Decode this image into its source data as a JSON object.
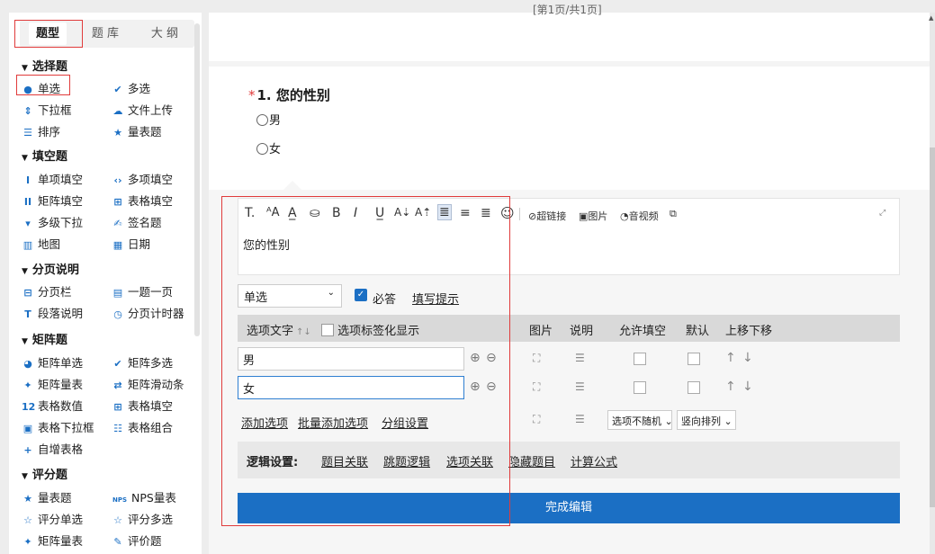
{
  "palette": {
    "brand": "#1b6fc4",
    "focus_box": "#e03b3b",
    "required": "#e03b3b"
  },
  "left_panel": {
    "tabs": [
      {
        "label": "题型",
        "active": true
      },
      {
        "label": "题 库",
        "active": false
      },
      {
        "label": "大 纲",
        "active": false
      }
    ],
    "sections": [
      {
        "title": "选择题",
        "items": [
          {
            "label": "单选",
            "icon": "radio-dot-icon",
            "glyph": "●"
          },
          {
            "label": "多选",
            "icon": "check-icon",
            "glyph": "✔"
          },
          {
            "label": "下拉框",
            "icon": "dropdown-arrows-icon",
            "glyph": "⇕"
          },
          {
            "label": "文件上传",
            "icon": "cloud-upload-icon",
            "glyph": "☁"
          },
          {
            "label": "排序",
            "icon": "list-icon",
            "glyph": "☰"
          },
          {
            "label": "量表题",
            "icon": "star-icon",
            "glyph": "★"
          }
        ]
      },
      {
        "title": "填空题",
        "items": [
          {
            "label": "单项填空",
            "icon": "text-cursor-icon",
            "glyph": "I"
          },
          {
            "label": "多项填空",
            "icon": "code-brackets-icon",
            "glyph": "‹›"
          },
          {
            "label": "矩阵填空",
            "icon": "double-cursor-icon",
            "glyph": "II"
          },
          {
            "label": "表格填空",
            "icon": "table-icon",
            "glyph": "⊞"
          },
          {
            "label": "多级下拉",
            "icon": "funnel-icon",
            "glyph": "▾"
          },
          {
            "label": "签名题",
            "icon": "pen-signature-icon",
            "glyph": "✍"
          },
          {
            "label": "地图",
            "icon": "map-icon",
            "glyph": "▥"
          },
          {
            "label": "日期",
            "icon": "calendar-icon",
            "glyph": "▦"
          }
        ]
      },
      {
        "title": "分页说明",
        "items": [
          {
            "label": "分页栏",
            "icon": "page-break-icon",
            "glyph": "⊟"
          },
          {
            "label": "一题一页",
            "icon": "single-page-icon",
            "glyph": "▤"
          },
          {
            "label": "段落说明",
            "icon": "text-t-icon",
            "glyph": "T"
          },
          {
            "label": "分页计时器",
            "icon": "timer-icon",
            "glyph": "◷"
          }
        ]
      },
      {
        "title": "矩阵题",
        "items": [
          {
            "label": "矩阵单选",
            "icon": "matrix-radio-icon",
            "glyph": "◕"
          },
          {
            "label": "矩阵多选",
            "icon": "matrix-check-icon",
            "glyph": "✔"
          },
          {
            "label": "矩阵量表",
            "icon": "matrix-star-icon",
            "glyph": "✦"
          },
          {
            "label": "矩阵滑动条",
            "icon": "slider-icon",
            "glyph": "⇄"
          },
          {
            "label": "表格数值",
            "icon": "number-12-icon",
            "glyph": "12"
          },
          {
            "label": "表格填空",
            "icon": "table-icon",
            "glyph": "⊞"
          },
          {
            "label": "表格下拉框",
            "icon": "table-dropdown-icon",
            "glyph": "▣"
          },
          {
            "label": "表格组合",
            "icon": "table-combo-icon",
            "glyph": "☷"
          },
          {
            "label": "自增表格",
            "icon": "plus-icon",
            "glyph": "+"
          }
        ]
      },
      {
        "title": "评分题",
        "items": [
          {
            "label": "量表题",
            "icon": "star-icon",
            "glyph": "★"
          },
          {
            "label": "NPS量表",
            "icon": "nps-icon",
            "glyph": "NPS"
          },
          {
            "label": "评分单选",
            "icon": "star-outline-icon",
            "glyph": "☆"
          },
          {
            "label": "评分多选",
            "icon": "star-outline-icon",
            "glyph": "☆"
          },
          {
            "label": "矩阵量表",
            "icon": "matrix-star-icon",
            "glyph": "✦"
          },
          {
            "label": "评价题",
            "icon": "pencil-icon",
            "glyph": "✎"
          }
        ]
      }
    ]
  },
  "page": {
    "pager": "[第1页/共1页]"
  },
  "question": {
    "required_mark": "*",
    "number": "1.",
    "title": "您的性别",
    "options": [
      "男",
      "女"
    ]
  },
  "editor": {
    "toolbar": {
      "items": [
        {
          "name": "clear-format-icon",
          "glyph": "T."
        },
        {
          "name": "font-size-icon",
          "glyph": "ᴬA"
        },
        {
          "name": "font-color-icon",
          "glyph": "A̲"
        },
        {
          "name": "highlight-icon",
          "glyph": "⛀"
        },
        {
          "name": "bold-icon",
          "glyph": "B"
        },
        {
          "name": "italic-icon",
          "glyph": "I"
        },
        {
          "name": "underline-icon",
          "glyph": "U̲"
        },
        {
          "name": "subscript-icon",
          "glyph": "A⇣"
        },
        {
          "name": "superscript-icon",
          "glyph": "A⇡"
        },
        {
          "name": "align-left-icon",
          "glyph": "≣"
        },
        {
          "name": "align-center-icon",
          "glyph": "≡"
        },
        {
          "name": "align-right-icon",
          "glyph": "≣"
        },
        {
          "name": "emoji-icon",
          "glyph": "☺"
        }
      ],
      "link_label": "超链接",
      "image_label": "图片",
      "media_label": "音视频",
      "expand_glyph": "⤢"
    },
    "title_text": "您的性别",
    "type_select": "单选",
    "required_label": "必答",
    "hint_link": "填写提示",
    "table": {
      "col_option_text": "选项文字",
      "sort_glyph": "↑↓",
      "col_tag_display": "选项标签化显示",
      "col_image": "图片",
      "col_desc": "说明",
      "col_fill": "允许填空",
      "col_default": "默认",
      "col_move": "上移下移",
      "rows": [
        "男",
        "女"
      ]
    },
    "add_option": "添加选项",
    "batch_add": "批量添加选项",
    "group_setting": "分组设置",
    "random_select": "选项不随机",
    "layout_select": "竖向排列",
    "logic": {
      "title": "逻辑设置:",
      "links": [
        "题目关联",
        "跳题逻辑",
        "选项关联",
        "隐藏题目",
        "计算公式"
      ]
    },
    "done_button": "完成编辑"
  }
}
